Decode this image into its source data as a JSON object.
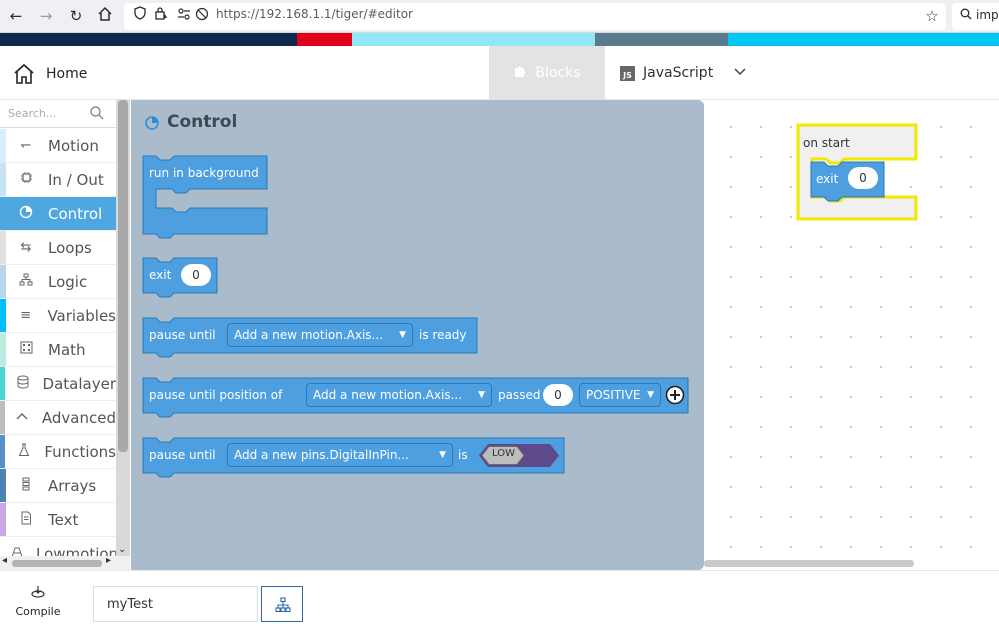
{
  "browser": {
    "url": "https://192.168.1.1/tiger/#editor",
    "search_text": "imp"
  },
  "header": {
    "home_label": "Home",
    "tabs": [
      {
        "label": "Blocks",
        "active": true
      },
      {
        "label": "JavaScript",
        "active": false
      }
    ],
    "js_badge": "JS"
  },
  "toolbox": {
    "search_placeholder": "Search...",
    "categories": [
      {
        "label": "Motion",
        "icon": "motion-icon",
        "color": "#d8ecfa"
      },
      {
        "label": "In / Out",
        "icon": "chip-icon",
        "color": "#c7e2f5"
      },
      {
        "label": "Control",
        "icon": "control-pie-icon",
        "color": "#4fa7e0",
        "selected": true
      },
      {
        "label": "Loops",
        "icon": "loop-icon",
        "color": "#e0e0e0"
      },
      {
        "label": "Logic",
        "icon": "logic-tree-icon",
        "color": "#b4d7ee"
      },
      {
        "label": "Variables",
        "icon": "variables-icon",
        "color": "#00bfff"
      },
      {
        "label": "Math",
        "icon": "calculator-icon",
        "color": "#bdebe0"
      },
      {
        "label": "Datalayer",
        "icon": "database-icon",
        "color": "#4ad6d6"
      },
      {
        "label": "Advanced",
        "icon": "chevron-up-icon",
        "color": "#bdbdbd"
      },
      {
        "label": "Functions",
        "icon": "flask-icon",
        "color": "#5a8fc8"
      },
      {
        "label": "Arrays",
        "icon": "array-icon",
        "color": "#4e83b3"
      },
      {
        "label": "Text",
        "icon": "text-doc-icon",
        "color": "#c9a8e6"
      },
      {
        "label": "Lowmotion",
        "icon": "lowmotion-icon",
        "color": "#e080b8"
      }
    ]
  },
  "flyout": {
    "title": "Control",
    "blocks": {
      "run_bg": "run in background",
      "exit_label": "exit",
      "exit_value": "0",
      "pause_until": "pause until",
      "pause_dropdown": "Add a new motion.Axis...",
      "is_ready": "is ready",
      "pause_pos": "pause until position of",
      "pos_dropdown": "Add a new motion.Axis...",
      "passed": "passed",
      "passed_value": "0",
      "direction": "POSITIVE",
      "pause_until_pin": "pause until",
      "pin_dropdown": "Add a new pins.DigitalInPin...",
      "is_label": "is",
      "low_value": "LOW"
    }
  },
  "workspace": {
    "on_start": "on start",
    "exit_label": "exit",
    "exit_value": "0"
  },
  "bottom": {
    "compile_label": "Compile",
    "project_name": "myTest"
  },
  "colors": {
    "block_blue": "#4e9fe0",
    "block_border": "#2c79b4",
    "flyout_bg": "#aabccb",
    "selected_cat": "#4fa7e0",
    "highlight_yellow": "#f2e800",
    "low_purple": "#5c4a8c"
  }
}
